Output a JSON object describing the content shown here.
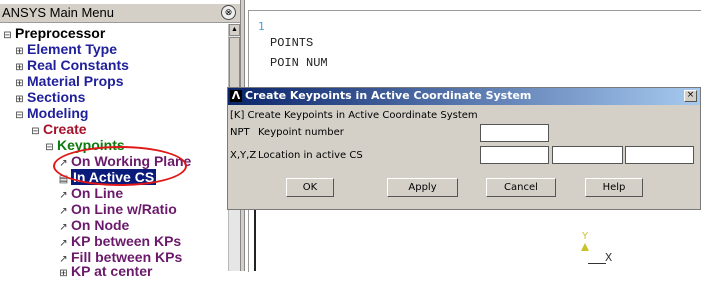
{
  "menu": {
    "title": "ANSYS Main Menu",
    "collapse_icon": "collapse-icon",
    "items": [
      {
        "label": "Preprocessor"
      },
      {
        "label": "Element Type"
      },
      {
        "label": "Real Constants"
      },
      {
        "label": "Material Props"
      },
      {
        "label": "Sections"
      },
      {
        "label": "Modeling"
      },
      {
        "label": "Create"
      },
      {
        "label": "Keypoints"
      },
      {
        "label": "On Working Plane"
      },
      {
        "label": "In Active CS"
      },
      {
        "label": "On Line"
      },
      {
        "label": "On Line w/Ratio"
      },
      {
        "label": "On Node"
      },
      {
        "label": "KP between KPs"
      },
      {
        "label": "Fill between KPs"
      },
      {
        "label": "KP at center"
      }
    ]
  },
  "output": {
    "line_number": "1",
    "lines": [
      "POINTS",
      "POIN NUM"
    ],
    "axis": {
      "y_label": "Y",
      "x_label": "X"
    }
  },
  "dialog": {
    "title": "Create Keypoints in Active Coordinate System",
    "command_line": "[K]  Create Keypoints in Active Coordinate System",
    "npt_label": "NPT",
    "npt_desc": "Keypoint number",
    "xyz_label": "X,Y,Z",
    "xyz_desc": "Location in active CS",
    "npt_value": "",
    "x_value": "",
    "y_value": "",
    "z_value": "",
    "buttons": {
      "ok": "OK",
      "apply": "Apply",
      "cancel": "Cancel",
      "help": "Help"
    },
    "close_glyph": "×"
  },
  "colors": {
    "selected_bg": "#0a1a7a",
    "highlight_ellipse": "#e01818",
    "dialog_title_bg": "#0a246a"
  }
}
